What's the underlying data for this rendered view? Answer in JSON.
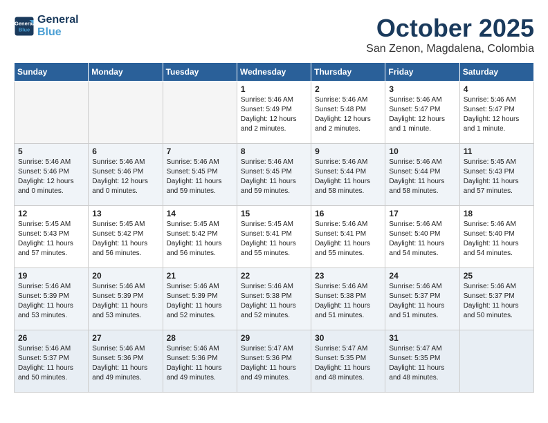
{
  "logo": {
    "line1": "General",
    "line2": "Blue"
  },
  "title": "October 2025",
  "location": "San Zenon, Magdalena, Colombia",
  "days_of_week": [
    "Sunday",
    "Monday",
    "Tuesday",
    "Wednesday",
    "Thursday",
    "Friday",
    "Saturday"
  ],
  "weeks": [
    [
      {
        "day": "",
        "info": ""
      },
      {
        "day": "",
        "info": ""
      },
      {
        "day": "",
        "info": ""
      },
      {
        "day": "1",
        "info": "Sunrise: 5:46 AM\nSunset: 5:49 PM\nDaylight: 12 hours and 2 minutes."
      },
      {
        "day": "2",
        "info": "Sunrise: 5:46 AM\nSunset: 5:48 PM\nDaylight: 12 hours and 2 minutes."
      },
      {
        "day": "3",
        "info": "Sunrise: 5:46 AM\nSunset: 5:47 PM\nDaylight: 12 hours and 1 minute."
      },
      {
        "day": "4",
        "info": "Sunrise: 5:46 AM\nSunset: 5:47 PM\nDaylight: 12 hours and 1 minute."
      }
    ],
    [
      {
        "day": "5",
        "info": "Sunrise: 5:46 AM\nSunset: 5:46 PM\nDaylight: 12 hours and 0 minutes."
      },
      {
        "day": "6",
        "info": "Sunrise: 5:46 AM\nSunset: 5:46 PM\nDaylight: 12 hours and 0 minutes."
      },
      {
        "day": "7",
        "info": "Sunrise: 5:46 AM\nSunset: 5:45 PM\nDaylight: 11 hours and 59 minutes."
      },
      {
        "day": "8",
        "info": "Sunrise: 5:46 AM\nSunset: 5:45 PM\nDaylight: 11 hours and 59 minutes."
      },
      {
        "day": "9",
        "info": "Sunrise: 5:46 AM\nSunset: 5:44 PM\nDaylight: 11 hours and 58 minutes."
      },
      {
        "day": "10",
        "info": "Sunrise: 5:46 AM\nSunset: 5:44 PM\nDaylight: 11 hours and 58 minutes."
      },
      {
        "day": "11",
        "info": "Sunrise: 5:45 AM\nSunset: 5:43 PM\nDaylight: 11 hours and 57 minutes."
      }
    ],
    [
      {
        "day": "12",
        "info": "Sunrise: 5:45 AM\nSunset: 5:43 PM\nDaylight: 11 hours and 57 minutes."
      },
      {
        "day": "13",
        "info": "Sunrise: 5:45 AM\nSunset: 5:42 PM\nDaylight: 11 hours and 56 minutes."
      },
      {
        "day": "14",
        "info": "Sunrise: 5:45 AM\nSunset: 5:42 PM\nDaylight: 11 hours and 56 minutes."
      },
      {
        "day": "15",
        "info": "Sunrise: 5:45 AM\nSunset: 5:41 PM\nDaylight: 11 hours and 55 minutes."
      },
      {
        "day": "16",
        "info": "Sunrise: 5:46 AM\nSunset: 5:41 PM\nDaylight: 11 hours and 55 minutes."
      },
      {
        "day": "17",
        "info": "Sunrise: 5:46 AM\nSunset: 5:40 PM\nDaylight: 11 hours and 54 minutes."
      },
      {
        "day": "18",
        "info": "Sunrise: 5:46 AM\nSunset: 5:40 PM\nDaylight: 11 hours and 54 minutes."
      }
    ],
    [
      {
        "day": "19",
        "info": "Sunrise: 5:46 AM\nSunset: 5:39 PM\nDaylight: 11 hours and 53 minutes."
      },
      {
        "day": "20",
        "info": "Sunrise: 5:46 AM\nSunset: 5:39 PM\nDaylight: 11 hours and 53 minutes."
      },
      {
        "day": "21",
        "info": "Sunrise: 5:46 AM\nSunset: 5:39 PM\nDaylight: 11 hours and 52 minutes."
      },
      {
        "day": "22",
        "info": "Sunrise: 5:46 AM\nSunset: 5:38 PM\nDaylight: 11 hours and 52 minutes."
      },
      {
        "day": "23",
        "info": "Sunrise: 5:46 AM\nSunset: 5:38 PM\nDaylight: 11 hours and 51 minutes."
      },
      {
        "day": "24",
        "info": "Sunrise: 5:46 AM\nSunset: 5:37 PM\nDaylight: 11 hours and 51 minutes."
      },
      {
        "day": "25",
        "info": "Sunrise: 5:46 AM\nSunset: 5:37 PM\nDaylight: 11 hours and 50 minutes."
      }
    ],
    [
      {
        "day": "26",
        "info": "Sunrise: 5:46 AM\nSunset: 5:37 PM\nDaylight: 11 hours and 50 minutes."
      },
      {
        "day": "27",
        "info": "Sunrise: 5:46 AM\nSunset: 5:36 PM\nDaylight: 11 hours and 49 minutes."
      },
      {
        "day": "28",
        "info": "Sunrise: 5:46 AM\nSunset: 5:36 PM\nDaylight: 11 hours and 49 minutes."
      },
      {
        "day": "29",
        "info": "Sunrise: 5:47 AM\nSunset: 5:36 PM\nDaylight: 11 hours and 49 minutes."
      },
      {
        "day": "30",
        "info": "Sunrise: 5:47 AM\nSunset: 5:35 PM\nDaylight: 11 hours and 48 minutes."
      },
      {
        "day": "31",
        "info": "Sunrise: 5:47 AM\nSunset: 5:35 PM\nDaylight: 11 hours and 48 minutes."
      },
      {
        "day": "",
        "info": ""
      }
    ]
  ]
}
